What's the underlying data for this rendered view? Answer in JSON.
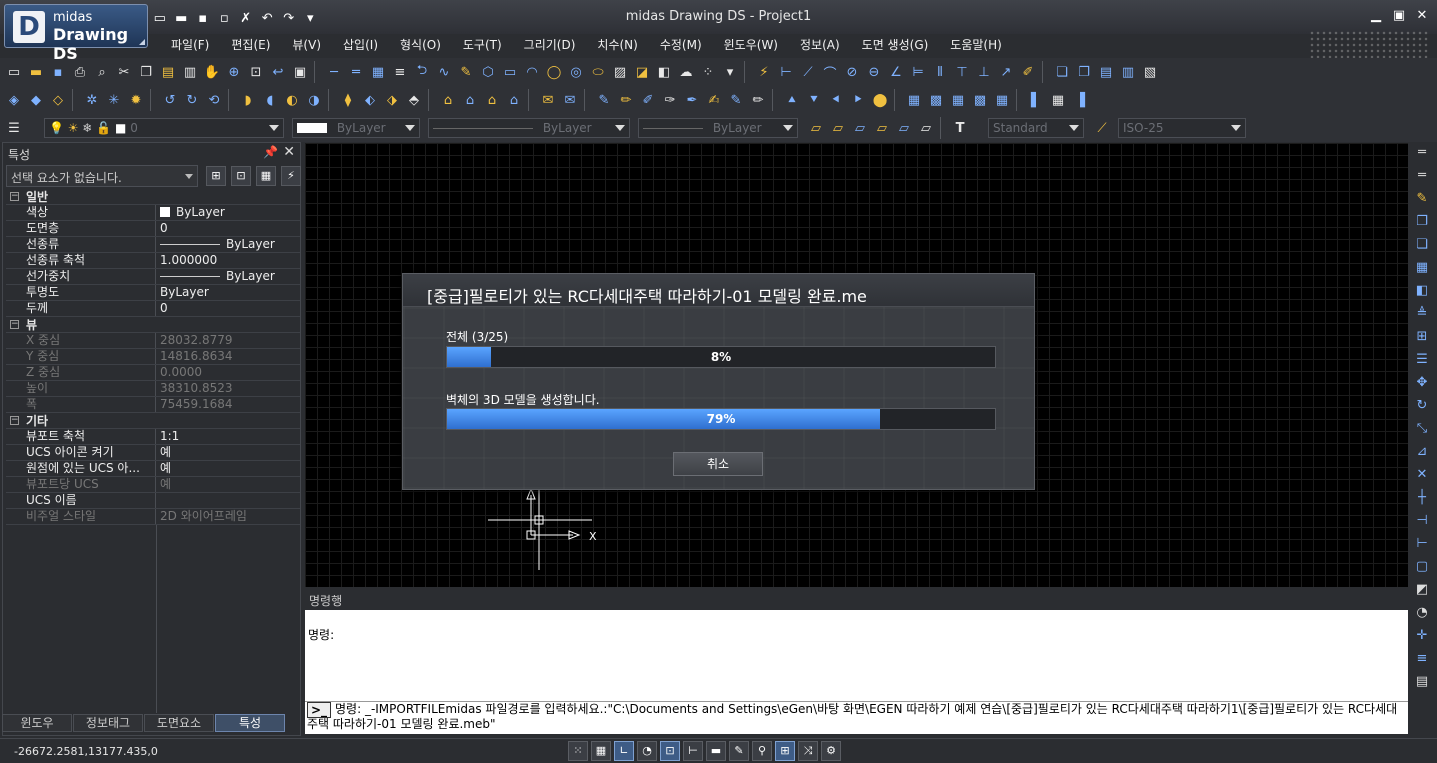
{
  "app": {
    "logo_line1": "midas",
    "logo_line2": "Drawing DS",
    "logo_letter": "D",
    "title": "midas Drawing DS - Project1"
  },
  "menu": [
    "파일(F)",
    "편집(E)",
    "뷰(V)",
    "삽입(I)",
    "형식(O)",
    "도구(T)",
    "그리기(D)",
    "치수(N)",
    "수정(M)",
    "윈도우(W)",
    "정보(A)",
    "도면 생성(G)",
    "도움말(H)"
  ],
  "layer_toolbar": {
    "layer_value": "0",
    "color_value": "ByLayer",
    "linetype_value": "ByLayer",
    "lineweight_value": "ByLayer",
    "text_style": "Standard",
    "dim_style": "ISO-25"
  },
  "properties": {
    "title": "특성",
    "selection": "선택 요소가 없습니다.",
    "categories": [
      {
        "name": "일반",
        "rows": [
          {
            "key": "색상",
            "value": "ByLayer",
            "dim": false
          },
          {
            "key": "도면층",
            "value": "0",
            "dim": false
          },
          {
            "key": "선종류",
            "value": "ByLayer",
            "dim": false
          },
          {
            "key": "선종류 축척",
            "value": "1.000000",
            "dim": false
          },
          {
            "key": "선가중치",
            "value": "ByLayer",
            "dim": false
          },
          {
            "key": "투명도",
            "value": "ByLayer",
            "dim": false
          },
          {
            "key": "두께",
            "value": "0",
            "dim": false
          }
        ]
      },
      {
        "name": "뷰",
        "rows": [
          {
            "key": "X 중심",
            "value": "28032.8779",
            "dim": true
          },
          {
            "key": "Y 중심",
            "value": "14816.8634",
            "dim": true
          },
          {
            "key": "Z 중심",
            "value": "0.0000",
            "dim": true
          },
          {
            "key": "높이",
            "value": "38310.8523",
            "dim": true
          },
          {
            "key": "폭",
            "value": "75459.1684",
            "dim": true
          }
        ]
      },
      {
        "name": "기타",
        "rows": [
          {
            "key": "뷰포트 축척",
            "value": "1:1",
            "dim": false
          },
          {
            "key": "UCS 아이콘 켜기",
            "value": "예",
            "dim": false
          },
          {
            "key": "원점에 있는 UCS 아...",
            "value": "예",
            "dim": false
          },
          {
            "key": "뷰포트당 UCS",
            "value": "예",
            "dim": true
          },
          {
            "key": "UCS 이름",
            "value": "",
            "dim": false
          },
          {
            "key": "비주얼 스타일",
            "value": "2D 와이어프레임",
            "dim": true
          }
        ]
      }
    ],
    "tabs": [
      "윈도우",
      "정보태그",
      "도면요소",
      "특성"
    ],
    "active_tab": 3
  },
  "dialog": {
    "title": "[중급]필로티가 있는 RC다세대주택 따라하기-01 모델링 완료.me",
    "overall_label": "전체 (3/25)",
    "overall_progress": 8,
    "overall_pct_text": "8%",
    "step_label": "벽체의 3D 모델을 생성합니다.",
    "step_progress": 79,
    "step_pct_text": "79%",
    "cancel_label": "취소"
  },
  "ucs": {
    "x_label": "X"
  },
  "command": {
    "header": "명령행",
    "history": "명령:",
    "current": "명령:  _-IMPORTFILEmidas 파일경로를 입력하세요.:\"C:\\Documents and Settings\\eGen\\바탕 화면\\EGEN 따라하기 예제 연습\\[중급]필로티가 있는 RC다세대주택 따라하기1\\[중급]필로티가 있는 RC다세대주택 따라하기-01 모델링 완료.meb\""
  },
  "status": {
    "coords": "-26672.2581,13177.435,0"
  },
  "colors": {
    "accent": "#3d7fe0",
    "background": "#2b2d31",
    "canvas": "#000000"
  }
}
